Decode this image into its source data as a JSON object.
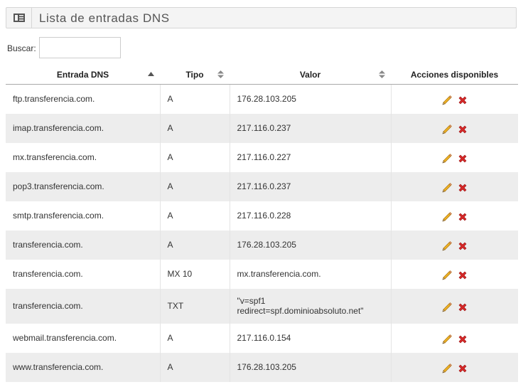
{
  "panel": {
    "title": "Lista de entradas DNS",
    "icon": "list-icon"
  },
  "search": {
    "label": "Buscar:",
    "value": "",
    "placeholder": ""
  },
  "table": {
    "columns": [
      {
        "label": "Entrada DNS",
        "sort": "ascending"
      },
      {
        "label": "Tipo",
        "sort": "sortable"
      },
      {
        "label": "Valor",
        "sort": "sortable"
      },
      {
        "label": "Acciones disponibles",
        "sort": "none"
      }
    ],
    "rows": [
      {
        "entry": "ftp.transferencia.com.",
        "type": "A",
        "value": "176.28.103.205"
      },
      {
        "entry": "imap.transferencia.com.",
        "type": "A",
        "value": "217.116.0.237"
      },
      {
        "entry": "mx.transferencia.com.",
        "type": "A",
        "value": "217.116.0.227"
      },
      {
        "entry": "pop3.transferencia.com.",
        "type": "A",
        "value": "217.116.0.237"
      },
      {
        "entry": "smtp.transferencia.com.",
        "type": "A",
        "value": "217.116.0.228"
      },
      {
        "entry": "transferencia.com.",
        "type": "A",
        "value": "176.28.103.205"
      },
      {
        "entry": "transferencia.com.",
        "type": "MX 10",
        "value": "mx.transferencia.com."
      },
      {
        "entry": "transferencia.com.",
        "type": "TXT",
        "value": "\"v=spf1 redirect=spf.dominioabsoluto.net\""
      },
      {
        "entry": "webmail.transferencia.com.",
        "type": "A",
        "value": "217.116.0.154"
      },
      {
        "entry": "www.transferencia.com.",
        "type": "A",
        "value": "176.28.103.205"
      }
    ],
    "actions": {
      "edit_icon": "pencil-icon",
      "delete_icon": "close-icon"
    }
  },
  "colors": {
    "edit": "#e8a317",
    "delete": "#d62828",
    "stripe": "#ededed",
    "header_border": "#a9a9a9"
  }
}
